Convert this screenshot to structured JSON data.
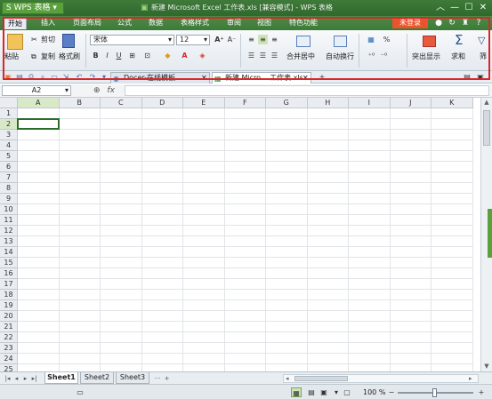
{
  "titlebar": {
    "app_button": "S WPS 表格 ▾",
    "title": "新建 Microsoft Excel 工作表.xls [兼容模式] - WPS 表格",
    "minimize": "—",
    "maximize": "☐",
    "close": "✕"
  },
  "menu": {
    "tabs": [
      "开始",
      "插入",
      "页面布局",
      "公式",
      "数据",
      "表格样式",
      "审阅",
      "视图",
      "特色功能"
    ],
    "login": "未登录"
  },
  "ribbon": {
    "paste": "粘贴",
    "cut": "剪切",
    "copy": "复制",
    "format_painter": "格式刷",
    "font_name": "宋体",
    "font_size": "12",
    "bold": "B",
    "italic": "I",
    "underline": "U",
    "merge_center": "合并居中",
    "auto_wrap": "自动换行",
    "percent": "%",
    "highlight": "突出显示",
    "sum": "求和",
    "filter": "筛"
  },
  "docbar": {
    "tabs": [
      {
        "label": "Docer-在线模板"
      },
      {
        "label": "新建 Micro....工作表.xls"
      }
    ],
    "add": "+"
  },
  "formula": {
    "namebox": "A2",
    "fx": "fx",
    "value": ""
  },
  "grid": {
    "columns": [
      "A",
      "B",
      "C",
      "D",
      "E",
      "F",
      "G",
      "H",
      "I",
      "J",
      "K"
    ],
    "rows": [
      "1",
      "2",
      "3",
      "4",
      "5",
      "6",
      "7",
      "8",
      "9",
      "10",
      "11",
      "12",
      "13",
      "14",
      "15",
      "16",
      "17",
      "18",
      "19",
      "20",
      "21",
      "22",
      "23",
      "24",
      "25"
    ],
    "selected_cell": "A2"
  },
  "sheets": {
    "tabs": [
      "Sheet1",
      "Sheet2",
      "Sheet3"
    ],
    "active": "Sheet1",
    "more": "···",
    "add": "+"
  },
  "status": {
    "zoom": "100 %",
    "zoom_minus": "−",
    "zoom_plus": "+"
  }
}
